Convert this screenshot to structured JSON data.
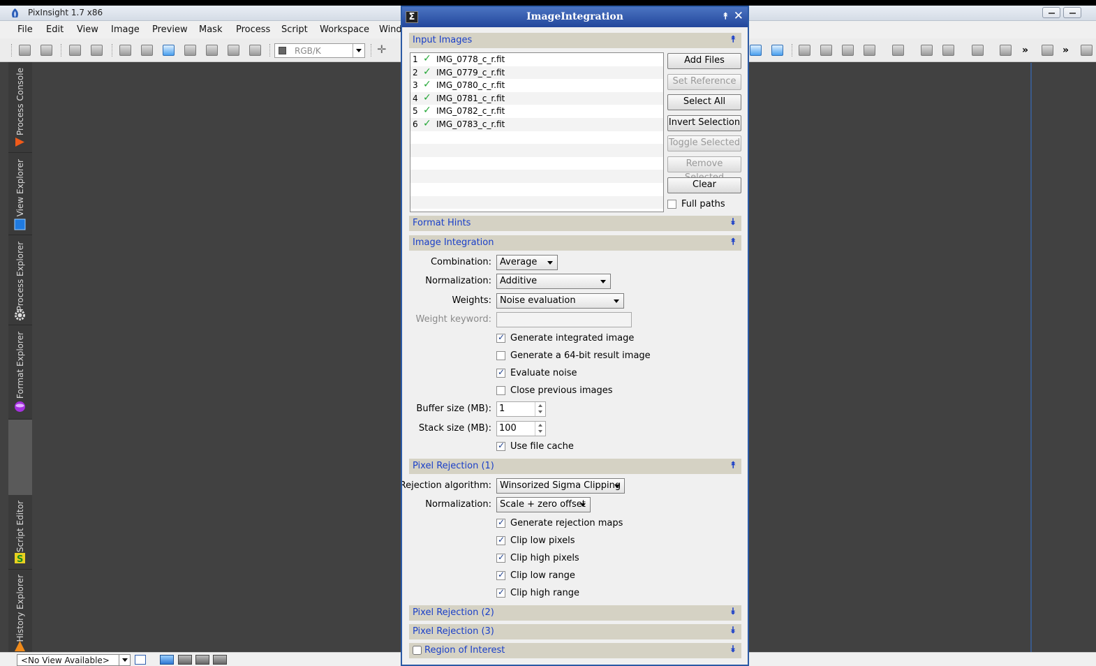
{
  "app": {
    "title": "PixInsight 1.7 x86",
    "menu": [
      "File",
      "Edit",
      "View",
      "Image",
      "Preview",
      "Mask",
      "Process",
      "Script",
      "Workspace",
      "Wind"
    ],
    "toolbar": {
      "color_mode": "RGB/K",
      "overflow_1": "»",
      "overflow_2": "»"
    },
    "dock_tabs": [
      {
        "label": "Process Console",
        "icon": "process-console-icon"
      },
      {
        "label": "View Explorer",
        "icon": "view-explorer-icon"
      },
      {
        "label": "Process Explorer",
        "icon": "gear-icon"
      },
      {
        "label": "Format Explorer",
        "icon": "purple-sphere-icon"
      },
      {
        "label": "Script Editor",
        "icon": "script-editor-icon"
      },
      {
        "label": "History Explorer",
        "icon": "history-explorer-icon"
      }
    ],
    "bottom": {
      "view_selector": "<No View Available>"
    }
  },
  "dialog": {
    "title": "ImageIntegration",
    "input_images": {
      "title": "Input Images",
      "files": [
        {
          "index": "1",
          "name": "IMG_0778_c_r.fit"
        },
        {
          "index": "2",
          "name": "IMG_0779_c_r.fit"
        },
        {
          "index": "3",
          "name": "IMG_0780_c_r.fit"
        },
        {
          "index": "4",
          "name": "IMG_0781_c_r.fit"
        },
        {
          "index": "5",
          "name": "IMG_0782_c_r.fit"
        },
        {
          "index": "6",
          "name": "IMG_0783_c_r.fit"
        }
      ],
      "buttons": {
        "add_files": "Add Files",
        "set_reference": "Set Reference",
        "select_all": "Select All",
        "invert_selection": "Invert Selection",
        "toggle_selected": "Toggle Selected",
        "remove_selected": "Remove Selected",
        "clear": "Clear"
      },
      "full_paths": "Full paths"
    },
    "format_hints": {
      "title": "Format Hints"
    },
    "image_integration": {
      "title": "Image Integration",
      "combination_label": "Combination:",
      "combination_value": "Average",
      "normalization_label": "Normalization:",
      "normalization_value": "Additive",
      "weights_label": "Weights:",
      "weights_value": "Noise evaluation",
      "weight_keyword_label": "Weight keyword:",
      "weight_keyword_value": "",
      "generate_integrated": "Generate integrated image",
      "generate_64bit": "Generate a 64-bit result image",
      "evaluate_noise": "Evaluate noise",
      "close_previous": "Close previous images",
      "buffer_size_label": "Buffer size (MB):",
      "buffer_size_value": "1",
      "stack_size_label": "Stack size (MB):",
      "stack_size_value": "100",
      "use_file_cache": "Use file cache"
    },
    "pixel_rejection_1": {
      "title": "Pixel Rejection (1)",
      "algorithm_label": "Rejection algorithm:",
      "algorithm_value": "Winsorized Sigma Clipping",
      "normalization_label": "Normalization:",
      "normalization_value": "Scale + zero offset",
      "generate_maps": "Generate rejection maps",
      "clip_low_pixels": "Clip low pixels",
      "clip_high_pixels": "Clip high pixels",
      "clip_low_range": "Clip low range",
      "clip_high_range": "Clip high range"
    },
    "pixel_rejection_2": {
      "title": "Pixel Rejection (2)"
    },
    "pixel_rejection_3": {
      "title": "Pixel Rejection (3)"
    },
    "region_of_interest": {
      "title": "Region of Interest"
    },
    "toggles": {
      "expanded": "⯭",
      "collapsed": "⯯"
    }
  }
}
